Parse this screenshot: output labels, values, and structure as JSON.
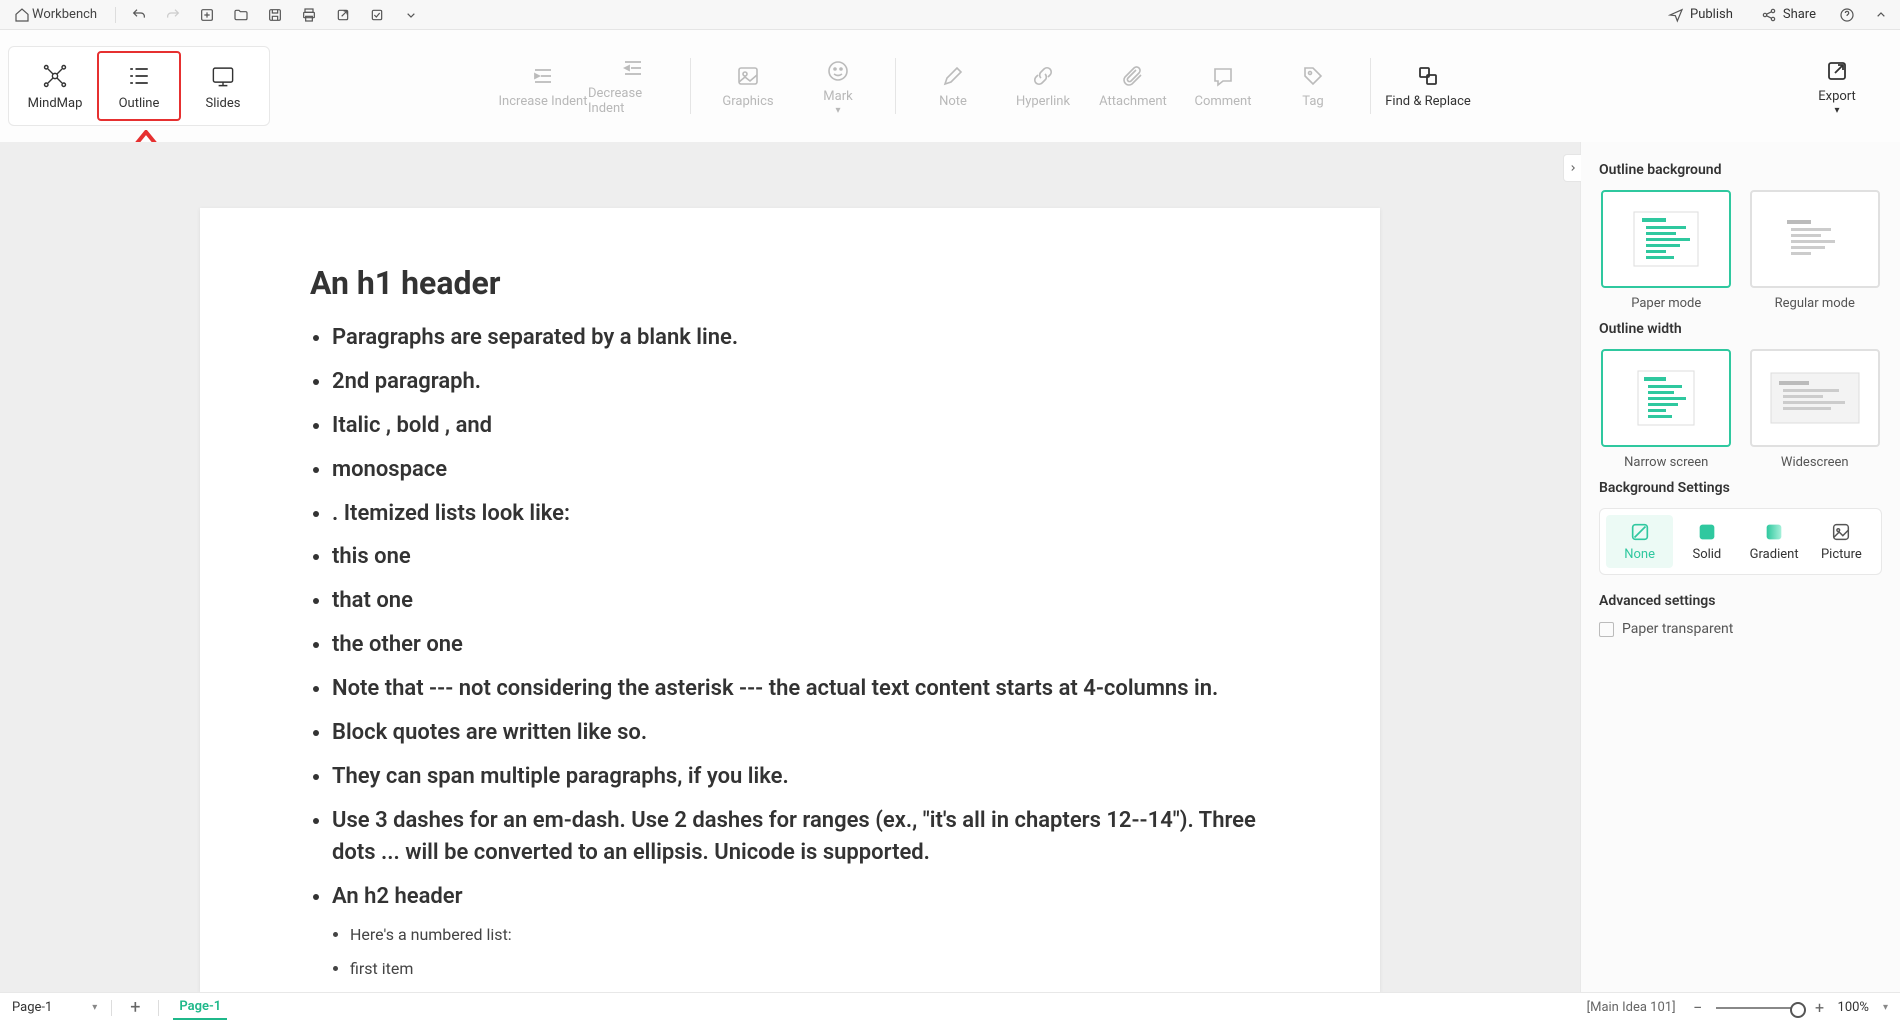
{
  "menubar": {
    "workbench": "Workbench",
    "publish": "Publish",
    "share": "Share"
  },
  "view_modes": {
    "mindmap": "MindMap",
    "outline": "Outline",
    "slides": "Slides"
  },
  "toolbar": {
    "increase_indent": "Increase Indent",
    "decrease_indent": "Decrease Indent",
    "graphics": "Graphics",
    "mark": "Mark",
    "note": "Note",
    "hyperlink": "Hyperlink",
    "attachment": "Attachment",
    "comment": "Comment",
    "tag": "Tag",
    "find_replace": "Find & Replace",
    "export": "Export"
  },
  "document": {
    "h1": "An h1 header",
    "items": [
      "Paragraphs are separated by a blank line.",
      "2nd paragraph.",
      "Italic , bold , and",
      "monospace",
      ". Itemized lists look like:",
      "this one",
      "that one",
      "the other one",
      "Note that --- not considering the asterisk --- the actual text content starts at 4-columns in.",
      "Block quotes are written like so.",
      "They can span multiple paragraphs, if you like.",
      "Use 3 dashes for an em-dash. Use 2 dashes for ranges (ex., \"it's all in chapters 12--14\"). Three dots ... will be converted to an ellipsis. Unicode is supported.",
      "An h2 header"
    ],
    "sub_items": [
      "Here's a numbered list:",
      "first item"
    ]
  },
  "right_panel": {
    "bg_heading": "Outline background",
    "paper_mode": "Paper mode",
    "regular_mode": "Regular mode",
    "width_heading": "Outline width",
    "narrow": "Narrow screen",
    "wide": "Widescreen",
    "bg_settings_heading": "Background Settings",
    "none": "None",
    "solid": "Solid",
    "gradient": "Gradient",
    "picture": "Picture",
    "advanced_heading": "Advanced settings",
    "paper_transparent": "Paper transparent"
  },
  "status": {
    "page_select": "Page-1",
    "page_tab": "Page-1",
    "main_idea": "[Main Idea 101]",
    "zoom": "100%"
  }
}
